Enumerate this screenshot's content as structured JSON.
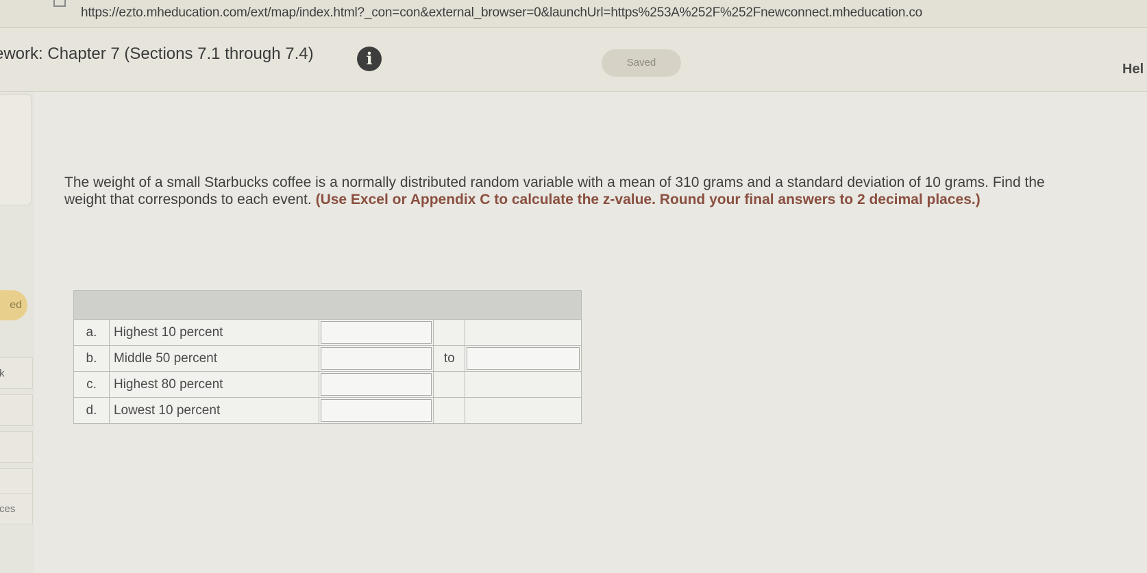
{
  "browser": {
    "url": "https://ezto.mheducation.com/ext/map/index.html?_con=con&external_browser=0&launchUrl=https%253A%252F%252Fnewconnect.mheducation.co"
  },
  "header": {
    "title": "ework: Chapter 7 (Sections 7.1 through 7.4)",
    "saved_label": "Saved",
    "help_label": "Hel"
  },
  "left_rail": {
    "pill_label": "ed",
    "item_k_label": "k",
    "item_ces_label": "ces"
  },
  "question": {
    "text": "The weight of a small Starbucks coffee is a normally distributed random variable with a mean of 310 grams and a standard deviation of 10 grams. Find the weight that corresponds to each event.",
    "instruction": "(Use Excel or Appendix C to calculate the z-value. Round your final answers to 2 decimal places.)"
  },
  "answer_table": {
    "rows": [
      {
        "letter": "a.",
        "event": "Highest 10 percent",
        "value": "",
        "to_label": "",
        "value2": null
      },
      {
        "letter": "b.",
        "event": "Middle 50 percent",
        "value": "",
        "to_label": "to",
        "value2": ""
      },
      {
        "letter": "c.",
        "event": "Highest 80 percent",
        "value": "",
        "to_label": "",
        "value2": null
      },
      {
        "letter": "d.",
        "event": "Lowest 10 percent",
        "value": "",
        "to_label": "",
        "value2": null
      }
    ]
  },
  "colors": {
    "instruction_text": "#8a4f40",
    "saved_badge_bg": "#d6d3c6",
    "rail_pill_bg": "#e9cf8c"
  }
}
